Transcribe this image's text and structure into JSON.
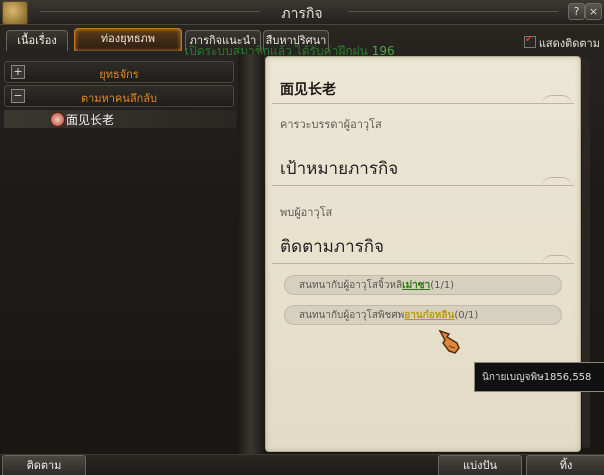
{
  "window": {
    "title": "ภารกิจ",
    "help_label": "?",
    "close_label": "×"
  },
  "tabs": [
    {
      "label": "เนื้อเรื่อง",
      "active": false
    },
    {
      "label": "ท่องยุทธภพ",
      "active": true
    },
    {
      "label": "ภารกิจแนะนำ",
      "active": false
    },
    {
      "label": "สืบหาปริศนา",
      "active": false
    }
  ],
  "notice": {
    "text": "เปิดระบบสมาชิกแล้ว ได้รับค่าฝึกฝน",
    "value": "196"
  },
  "show_amount": {
    "label": "แสดงติดตาม",
    "checked": true
  },
  "categories": [
    {
      "toggle": "+",
      "label": "ยุทธจักร"
    },
    {
      "toggle": "−",
      "label": "ตามหาคนลึกลับ"
    }
  ],
  "quest_list": [
    {
      "title": "面见长老"
    }
  ],
  "detail": {
    "quest_name": "面见长老",
    "desc_label": "คารวะบรรดาผู้อาวุโส",
    "goal_heading": "เป้าหมายภารกิจ",
    "goal_text": "พบผู้อาวุโส",
    "track_heading": "ติดตามภารกิจ",
    "requirements": [
      {
        "prefix": "สนทนากับผู้อาวุโสจิ้วหลิ",
        "target": "เม่าซา",
        "progress": "(1/1)"
      },
      {
        "prefix": "สนทนากับผู้อาวุโสพิชศพ",
        "target": "อานก๋อหลิน",
        "progress": "(0/1)"
      }
    ]
  },
  "tooltip": {
    "text": "นิกายเบญจพิษ1856,558"
  },
  "buttons": {
    "track": "ติดตาม",
    "share": "แบ่งปัน",
    "abandon": "ทิ้ง"
  },
  "colors": {
    "accent": "#e08a2a",
    "parchment": "#e6e0cc",
    "progress_green": "#2f7a12"
  }
}
